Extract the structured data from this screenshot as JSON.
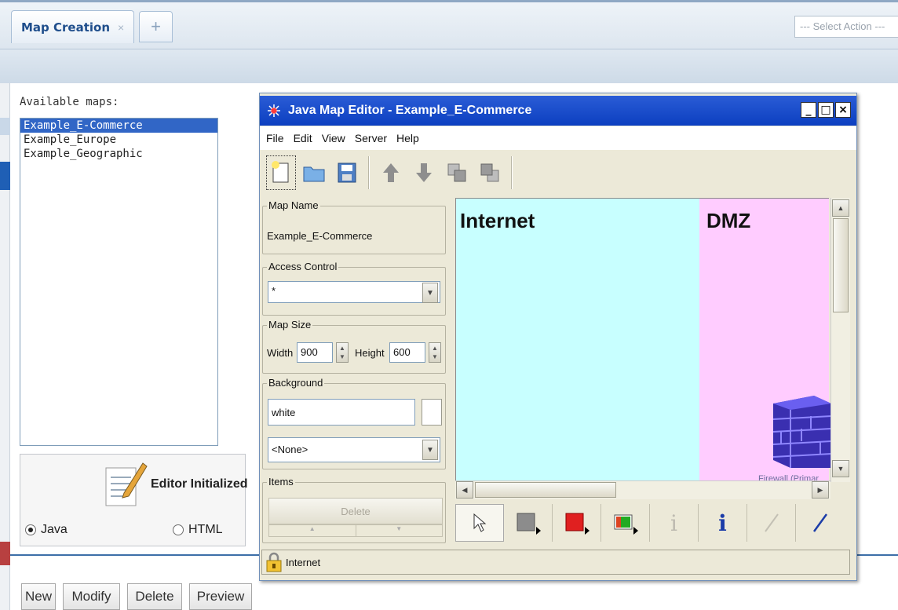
{
  "app": {
    "tabs": [
      {
        "label": "Map Creation",
        "close": "×"
      }
    ],
    "add_tab": "+",
    "select_action": "--- Select Action ---"
  },
  "maps_panel": {
    "label": "Available maps:",
    "items": [
      "Example_E-Commerce",
      "Example_Europe",
      "Example_Geographic"
    ],
    "selected": "Example_E-Commerce",
    "status": "Editor Initialized",
    "radio_java": "Java",
    "radio_html": "HTML",
    "radio_selected": "Java"
  },
  "bottom_buttons": {
    "new": "New",
    "modify": "Modify",
    "delete": "Delete",
    "preview": "Preview"
  },
  "editor": {
    "title": "Java Map Editor - Example_E-Commerce",
    "window_buttons": {
      "min": "_",
      "max": "□",
      "close": "×"
    },
    "menu": [
      "File",
      "Edit",
      "View",
      "Server",
      "Help"
    ],
    "toolbar_icons": [
      "new-map-icon",
      "open-folder-icon",
      "save-icon",
      "move-up-icon",
      "move-down-icon",
      "layer-back-icon",
      "layer-front-icon"
    ],
    "map_name": {
      "title": "Map Name",
      "value": "Example_E-Commerce"
    },
    "access_control": {
      "title": "Access Control",
      "value": "*"
    },
    "map_size": {
      "title": "Map Size",
      "width_label": "Width",
      "width": "900",
      "height_label": "Height",
      "height": "600"
    },
    "background": {
      "title": "Background",
      "color": "white",
      "image": "<None>"
    },
    "items": {
      "title": "Items",
      "delete_label": "Delete"
    },
    "canvas": {
      "zones": [
        {
          "label": "Internet",
          "color": "#c8ffff"
        },
        {
          "label": "DMZ",
          "color": "#ffccff"
        }
      ],
      "firewall_label": "Firewall (Primar"
    },
    "tools": [
      "pointer-icon",
      "gray-node-icon",
      "red-node-icon",
      "multi-color-node-icon",
      "info-disabled-icon",
      "info-icon",
      "line-disabled-icon",
      "line-icon"
    ],
    "status_text": "Internet",
    "status_icon": "lock-icon"
  },
  "colors": {
    "accent": "#1f4e8c",
    "selection": "#3166c6",
    "title_bar": "#0c3fc0"
  }
}
